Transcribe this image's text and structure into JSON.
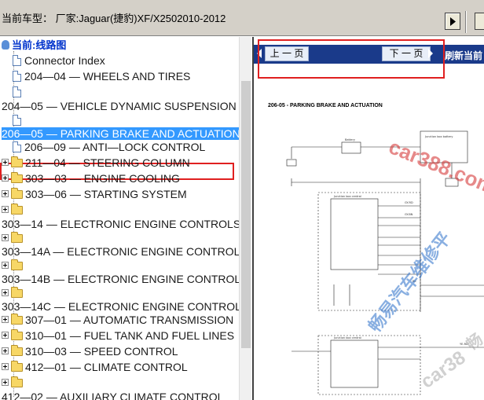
{
  "window": {
    "title_text": "当前车型：  厂家:Jaguar(捷豹)XF/X2502010-2012"
  },
  "tree": {
    "root_label": "当前:线路图",
    "items": [
      {
        "label": "Connector Index"
      },
      {
        "label": "204—04 — WHEELS AND TIRES"
      },
      {
        "label": "204—05 — VEHICLE DYNAMIC SUSPENSION"
      },
      {
        "label": "206—05 — PARKING BRAKE AND ACTUATION"
      },
      {
        "label": "206—09 — ANTI—LOCK CONTROL"
      },
      {
        "label": "211—04 — STEERING COLUMN"
      },
      {
        "label": "303—03 — ENGINE COOLING"
      },
      {
        "label": "303—06 — STARTING SYSTEM"
      },
      {
        "label": "303—14 — ELECTRONIC ENGINE CONTROLS —"
      },
      {
        "label": "303—14A — ELECTRONIC ENGINE CONTROLS —"
      },
      {
        "label": "303—14B — ELECTRONIC ENGINE CONTROLS —"
      },
      {
        "label": "303—14C — ELECTRONIC ENGINE CONTROLS —"
      },
      {
        "label": "307—01 — AUTOMATIC TRANSMISSION"
      },
      {
        "label": "310—01 — FUEL TANK AND FUEL LINES"
      },
      {
        "label": "310—03 — SPEED CONTROL"
      },
      {
        "label": "412—01 — CLIMATE CONTROL"
      },
      {
        "label": "412—02 — AUXILIARY CLIMATE CONTROL"
      }
    ]
  },
  "viewer": {
    "prev_label": "上 一 页",
    "next_label": "下 一 页",
    "refresh_label": "刷新当前",
    "diagram_title": "206-05 - PARKING BRAKE AND ACTUATION",
    "watermarks": [
      "car388.com",
      "畅易汽车维修平",
      "car38",
      "畅"
    ]
  },
  "colors": {
    "highlight_box": "#e02020",
    "selection": "#3399ff",
    "viewer_bar": "#1a3a8a"
  }
}
